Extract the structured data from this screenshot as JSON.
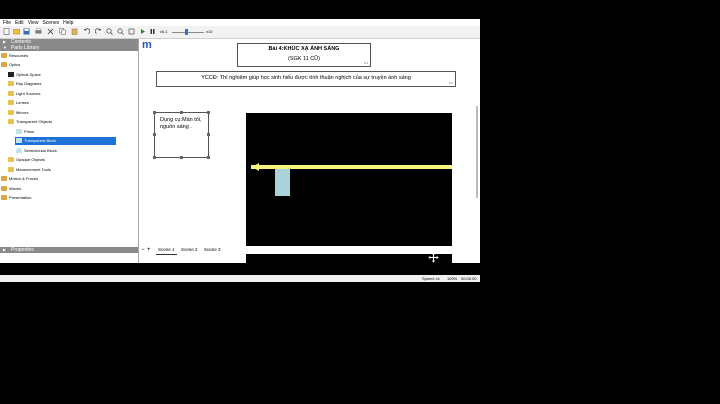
{
  "menu": [
    "File",
    "Edit",
    "View",
    "Scenes",
    "Help"
  ],
  "toolbar": {
    "zoom_min": "x0.1",
    "zoom_max": "x10"
  },
  "panels": {
    "contents": "Contents",
    "parts_library": "Parts Library",
    "properties": "Properties"
  },
  "tree": [
    {
      "label": "Resources"
    },
    {
      "label": "Optics"
    },
    {
      "label": "Optical Space"
    },
    {
      "label": "Ray Diagrams"
    },
    {
      "label": "Light Sources"
    },
    {
      "label": "Lenses"
    },
    {
      "label": "Mirrors"
    },
    {
      "label": "Transparent Objects"
    },
    {
      "label": "Prism"
    },
    {
      "label": "Transparent Block"
    },
    {
      "label": "Semicircular Block"
    },
    {
      "label": "Opaque Objects"
    },
    {
      "label": "Measurement Tools"
    },
    {
      "label": "Motion & Forces"
    },
    {
      "label": "Waves"
    },
    {
      "label": "Presentation"
    }
  ],
  "canvas": {
    "logo": "m",
    "title_line1": "Bài 4:KHÚC XẠ ÁNH SÁNG",
    "title_line2": "(SGK 11 CŨ)",
    "title_page": "1/1",
    "objective": "YCCĐ: Thí nghiệm giúp học sinh hiểu được tính thuận nghịch của sự truyền ánh sáng",
    "objective_page": "1/1",
    "note": "Dụng cụ:Màn tối, nguồn sáng ."
  },
  "scenes": [
    "Scene 1",
    "Scene 2",
    "Scene 3"
  ],
  "scene_controls": {
    "minus": "−",
    "plus": "+"
  },
  "status": {
    "speed": "Speed: x1",
    "percent": "100%",
    "time": "00:05.00"
  },
  "colors": {
    "ray": "#f4f47a",
    "block": "#a9d3d8",
    "selection": "#1e73d8"
  }
}
